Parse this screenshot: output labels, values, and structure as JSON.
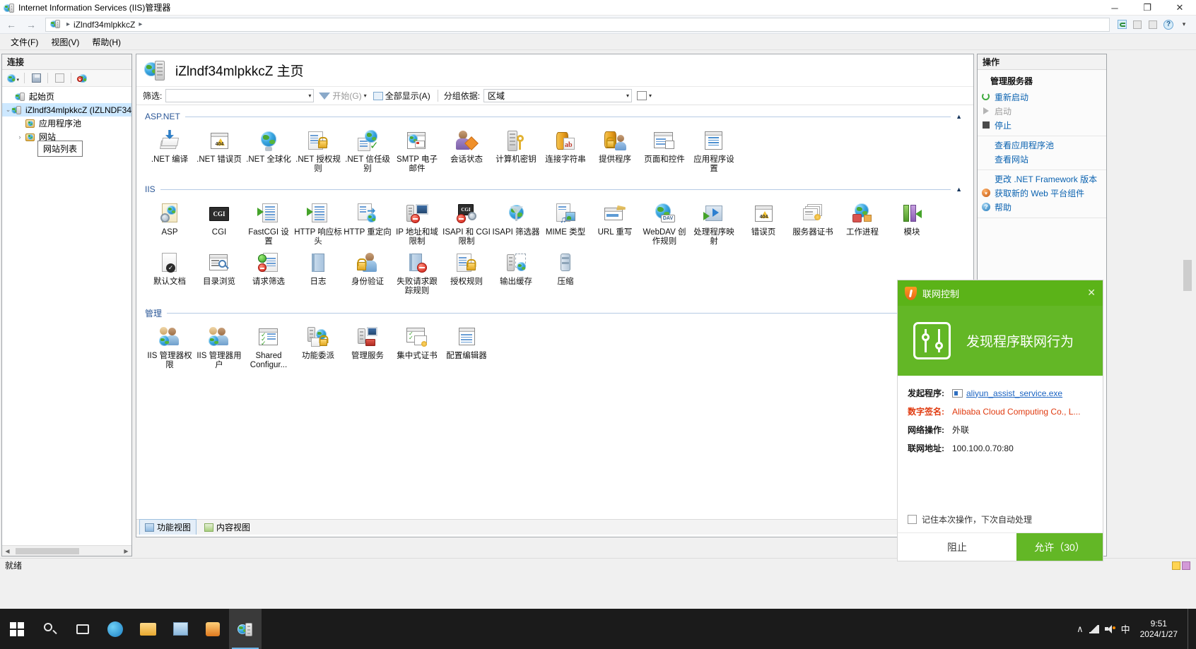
{
  "window": {
    "title": "Internet Information Services (IIS)管理器",
    "minimize": "─",
    "maximize": "❐",
    "close": "✕"
  },
  "address": {
    "back": "←",
    "forward": "→",
    "crumb_text": "iZlndf34mlpkkcZ",
    "separator": "▸"
  },
  "menu": {
    "items": [
      {
        "label": "文件(F)"
      },
      {
        "label": "视图(V)"
      },
      {
        "label": "帮助(H)"
      }
    ]
  },
  "connections": {
    "header": "连接",
    "tooltip": "网站列表",
    "tree": [
      {
        "label": "起始页",
        "indent": 0,
        "twist": "",
        "selected": false
      },
      {
        "label": "iZlndf34mlpkkcZ (IZLNDF34",
        "indent": 0,
        "twist": "⌄",
        "selected": true
      },
      {
        "label": "应用程序池",
        "indent": 1,
        "twist": "",
        "selected": false
      },
      {
        "label": "网站",
        "indent": 1,
        "twist": "›",
        "selected": false
      }
    ]
  },
  "main": {
    "page_title": "iZlndf34mlpkkcZ 主页",
    "filter": {
      "label": "筛选:",
      "value": "",
      "go_label": "开始(G)",
      "showall_label": "全部显示(A)",
      "groupby_label": "分组依据:",
      "groupby_value": "区域"
    },
    "groups": [
      {
        "name": "ASP.NET",
        "items": [
          {
            "label": ".NET 编译",
            "icon": "net-compilation-icon"
          },
          {
            "label": ".NET 错误页",
            "icon": "net-error-pages-icon"
          },
          {
            "label": ".NET 全球化",
            "icon": "net-globalization-icon"
          },
          {
            "label": ".NET 授权规则",
            "icon": "net-authorization-rules-icon"
          },
          {
            "label": ".NET 信任级别",
            "icon": "net-trust-levels-icon"
          },
          {
            "label": "SMTP 电子邮件",
            "icon": "smtp-email-icon"
          },
          {
            "label": "会话状态",
            "icon": "session-state-icon"
          },
          {
            "label": "计算机密钥",
            "icon": "machine-key-icon"
          },
          {
            "label": "连接字符串",
            "icon": "connection-strings-icon"
          },
          {
            "label": "提供程序",
            "icon": "providers-icon"
          },
          {
            "label": "页面和控件",
            "icon": "pages-and-controls-icon"
          },
          {
            "label": "应用程序设置",
            "icon": "application-settings-icon"
          }
        ]
      },
      {
        "name": "IIS",
        "items": [
          {
            "label": "ASP",
            "icon": "asp-icon"
          },
          {
            "label": "CGI",
            "icon": "cgi-icon"
          },
          {
            "label": "FastCGI 设置",
            "icon": "fastcgi-settings-icon"
          },
          {
            "label": "HTTP 响应标头",
            "icon": "http-response-headers-icon"
          },
          {
            "label": "HTTP 重定向",
            "icon": "http-redirect-icon"
          },
          {
            "label": "IP 地址和域限制",
            "icon": "ip-restrictions-icon"
          },
          {
            "label": "ISAPI 和 CGI 限制",
            "icon": "isapi-cgi-restrictions-icon"
          },
          {
            "label": "ISAPI 筛选器",
            "icon": "isapi-filters-icon"
          },
          {
            "label": "MIME 类型",
            "icon": "mime-types-icon"
          },
          {
            "label": "URL 重写",
            "icon": "url-rewrite-icon"
          },
          {
            "label": "WebDAV 创作规则",
            "icon": "webdav-authoring-rules-icon"
          },
          {
            "label": "处理程序映射",
            "icon": "handler-mappings-icon"
          },
          {
            "label": "错误页",
            "icon": "error-pages-icon"
          },
          {
            "label": "服务器证书",
            "icon": "server-certificates-icon"
          },
          {
            "label": "工作进程",
            "icon": "worker-processes-icon"
          },
          {
            "label": "模块",
            "icon": "modules-icon"
          },
          {
            "label": "默认文档",
            "icon": "default-document-icon"
          },
          {
            "label": "目录浏览",
            "icon": "directory-browsing-icon"
          },
          {
            "label": "请求筛选",
            "icon": "request-filtering-icon"
          },
          {
            "label": "日志",
            "icon": "logging-icon"
          },
          {
            "label": "身份验证",
            "icon": "authentication-icon"
          },
          {
            "label": "失败请求跟踪规则",
            "icon": "failed-request-tracing-icon"
          },
          {
            "label": "授权规则",
            "icon": "authorization-rules-icon"
          },
          {
            "label": "输出缓存",
            "icon": "output-caching-icon"
          },
          {
            "label": "压缩",
            "icon": "compression-icon"
          }
        ]
      },
      {
        "name": "管理",
        "items": [
          {
            "label": "IIS 管理器权限",
            "icon": "iis-manager-permissions-icon"
          },
          {
            "label": "IIS 管理器用户",
            "icon": "iis-manager-users-icon"
          },
          {
            "label": "Shared Configur...",
            "icon": "shared-configuration-icon"
          },
          {
            "label": "功能委派",
            "icon": "feature-delegation-icon"
          },
          {
            "label": "管理服务",
            "icon": "management-service-icon"
          },
          {
            "label": "集中式证书",
            "icon": "centralized-certificates-icon"
          },
          {
            "label": "配置编辑器",
            "icon": "configuration-editor-icon"
          }
        ]
      }
    ],
    "view_tabs": [
      {
        "label": "功能视图",
        "active": true
      },
      {
        "label": "内容视图",
        "active": false
      }
    ]
  },
  "actions": {
    "header": "操作",
    "group_title": "管理服务器",
    "items": [
      {
        "label": "重新启动",
        "icon": "restart-icon",
        "disabled": false,
        "has_icon": true
      },
      {
        "label": "启动",
        "icon": "start-icon",
        "disabled": true,
        "has_icon": true
      },
      {
        "label": "停止",
        "icon": "stop-icon",
        "disabled": false,
        "has_icon": true
      },
      {
        "label": "查看应用程序池",
        "icon": "",
        "disabled": false,
        "has_icon": false
      },
      {
        "label": "查看网站",
        "icon": "",
        "disabled": false,
        "has_icon": false
      },
      {
        "label": "更改 .NET Framework 版本",
        "icon": "",
        "disabled": false,
        "has_icon": false
      },
      {
        "label": "获取新的 Web 平台组件",
        "icon": "web-platform-icon",
        "disabled": false,
        "has_icon": true
      },
      {
        "label": "帮助",
        "icon": "help-icon",
        "disabled": false,
        "has_icon": true
      }
    ]
  },
  "status": {
    "text": "就绪"
  },
  "dialog": {
    "title": "联网控制",
    "close": "✕",
    "banner_text": "发现程序联网行为",
    "rows": [
      {
        "key": "发起程序:",
        "value": "aliyun_assist_service.exe",
        "style": "link",
        "has_exe_icon": true
      },
      {
        "key": "数字签名:",
        "value": "Alibaba Cloud Computing Co., L...",
        "style": "warn",
        "has_exe_icon": false
      },
      {
        "key": "网络操作:",
        "value": "外联",
        "style": "plain",
        "has_exe_icon": false
      },
      {
        "key": "联网地址:",
        "value": "100.100.0.70:80",
        "style": "plain",
        "has_exe_icon": false
      }
    ],
    "remember_label": "记住本次操作，下次自动处理",
    "deny_label": "阻止",
    "allow_label": "允许（30）"
  },
  "taskbar": {
    "clock_time": "9:51",
    "clock_date": "2024/1/27",
    "ime": "中",
    "tray_chevron": "∧"
  },
  "colors": {
    "accent_blue": "#2b5797",
    "link_blue": "#0a62b0",
    "selection": "#cde8ff",
    "dialog_green": "#63b726",
    "warn_orange": "#e03b10"
  }
}
